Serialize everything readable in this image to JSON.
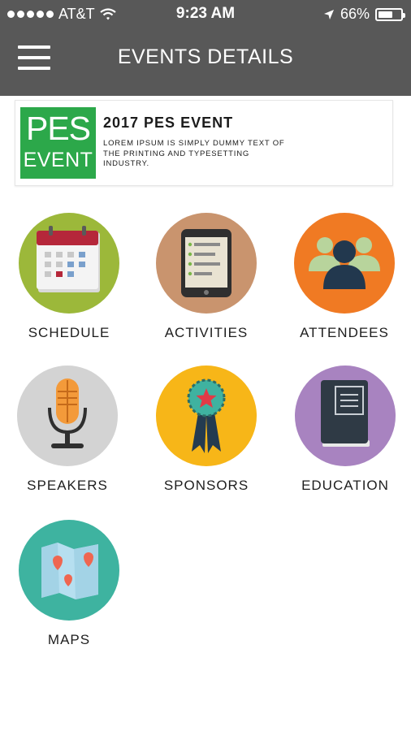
{
  "status_bar": {
    "carrier": "AT&T",
    "time": "9:23 AM",
    "battery_percent": "66%",
    "battery_level": 0.66
  },
  "header": {
    "title": "EVENTS DETAILS",
    "menu_icon": "hamburger-menu-icon",
    "background_color": "#585858"
  },
  "event": {
    "logo_line1": "PES",
    "logo_line2": "EVENT",
    "logo_color": "#2ca84a",
    "title": "2017 PES EVENT",
    "description": "LOREM IPSUM IS SIMPLY DUMMY TEXT OF THE PRINTING AND TYPESETTING INDUSTRY."
  },
  "menu": [
    {
      "label": "SCHEDULE",
      "icon": "calendar-icon",
      "color": "#9cb83a"
    },
    {
      "label": "ACTIVITIES",
      "icon": "tablet-icon",
      "color": "#c9946e"
    },
    {
      "label": "ATTENDEES",
      "icon": "people-icon",
      "color": "#f07a23"
    },
    {
      "label": "SPEAKERS",
      "icon": "microphone-icon",
      "color": "#d3d3d3"
    },
    {
      "label": "SPONSORS",
      "icon": "award-ribbon-icon",
      "color": "#f7b618"
    },
    {
      "label": "EDUCATION",
      "icon": "book-icon",
      "color": "#a883c0"
    },
    {
      "label": "MAPS",
      "icon": "map-icon",
      "color": "#3eb3a0"
    }
  ]
}
